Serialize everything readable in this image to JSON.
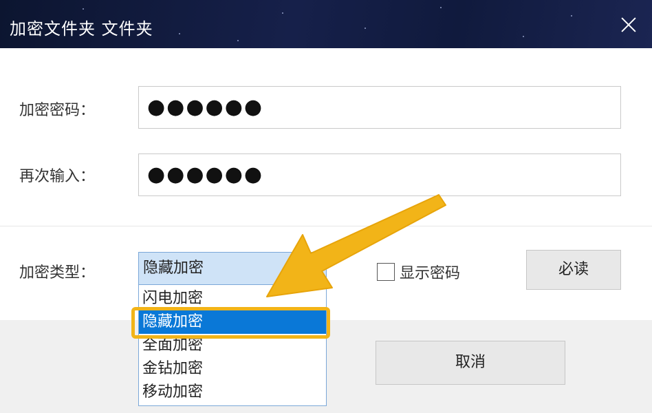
{
  "window": {
    "title": "加密文件夹 文件夹"
  },
  "form": {
    "password_label": "加密密码：",
    "password_value": "●●●●●●",
    "confirm_label": "再次输入：",
    "confirm_value": "●●●●●●",
    "type_label": "加密类型：",
    "type_selected": "隐藏加密",
    "type_options": [
      {
        "label": "闪电加密"
      },
      {
        "label": "隐藏加密"
      },
      {
        "label": "全面加密"
      },
      {
        "label": "金钻加密"
      },
      {
        "label": "移动加密"
      }
    ],
    "selected_index": 1,
    "show_password_label": "显示密码",
    "show_password_checked": false
  },
  "buttons": {
    "must_read": "必读",
    "cancel": "取消"
  },
  "colors": {
    "title_bg": "#101a3d",
    "selection": "#0a78d7",
    "annotation": "#f2b418",
    "select_bg": "#cfe3f7"
  },
  "icons": {
    "close": "close-icon",
    "annotation": "arrow-annotation-icon"
  }
}
